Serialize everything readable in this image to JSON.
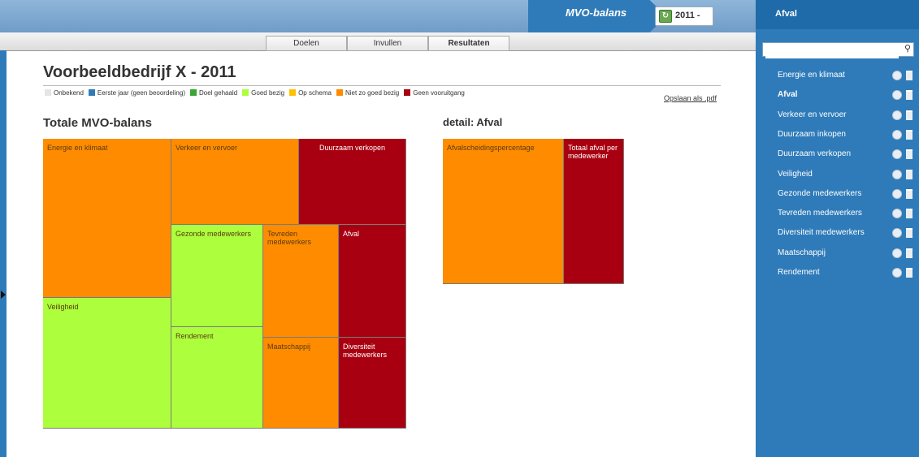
{
  "header": {
    "crumb_mvo": "MVO-balans",
    "crumb_year": "2011 -"
  },
  "tabs": [
    {
      "label": "Doelen",
      "active": false
    },
    {
      "label": "Invullen",
      "active": false
    },
    {
      "label": "Resultaten",
      "active": true
    }
  ],
  "sidebar": {
    "title": "Afval",
    "search_placeholder": "",
    "items": [
      {
        "label": "Energie en klimaat",
        "active": false
      },
      {
        "label": "Afval",
        "active": true
      },
      {
        "label": "Verkeer en vervoer",
        "active": false
      },
      {
        "label": "Duurzaam inkopen",
        "active": false
      },
      {
        "label": "Duurzaam verkopen",
        "active": false
      },
      {
        "label": "Veiligheid",
        "active": false
      },
      {
        "label": "Gezonde medewerkers",
        "active": false
      },
      {
        "label": "Tevreden medewerkers",
        "active": false
      },
      {
        "label": "Diversiteit medewerkers",
        "active": false
      },
      {
        "label": "Maatschappij",
        "active": false
      },
      {
        "label": "Rendement",
        "active": false
      }
    ]
  },
  "main": {
    "title": "Voorbeeldbedrijf X - 2011",
    "pdf_link": "Opslaan als .pdf",
    "legend": [
      {
        "label": "Onbekend",
        "color": "#e5e5e5"
      },
      {
        "label": "Eerste jaar (geen beoordeling)",
        "color": "#2f7bb9"
      },
      {
        "label": "Doel gehaald",
        "color": "#3aa635"
      },
      {
        "label": "Goed bezig",
        "color": "#adff3e"
      },
      {
        "label": "Op schema",
        "color": "#ffc000"
      },
      {
        "label": "Niet zo goed bezig",
        "color": "#ff8c00"
      },
      {
        "label": "Geen vooruitgang",
        "color": "#a80010"
      }
    ],
    "total_title": "Totale MVO-balans",
    "detail_title": "detail: Afval",
    "total_cells": [
      {
        "label": "Energie en klimaat",
        "status": "Niet zo goed bezig"
      },
      {
        "label": "Verkeer en vervoer",
        "status": "Niet zo goed bezig"
      },
      {
        "label": "Duurzaam verkopen",
        "status": "Geen vooruitgang"
      },
      {
        "label": "Veiligheid",
        "status": "Goed bezig"
      },
      {
        "label": "Gezonde medewerkers",
        "status": "Goed bezig"
      },
      {
        "label": "Tevreden medewerkers",
        "status": "Niet zo goed bezig"
      },
      {
        "label": "Afval",
        "status": "Geen vooruitgang"
      },
      {
        "label": "Rendement",
        "status": "Goed bezig"
      },
      {
        "label": "Maatschappij",
        "status": "Niet zo goed bezig"
      },
      {
        "label": "Diversiteit medewerkers",
        "status": "Geen vooruitgang"
      }
    ],
    "detail_cells": [
      {
        "label": "Afvalscheidingspercentage",
        "status": "Niet zo goed bezig"
      },
      {
        "label": "Totaal afval per medewerker",
        "status": "Geen vooruitgang"
      }
    ],
    "colors": {
      "orange": "#ff8c00",
      "red": "#a80010",
      "green": "#adff3e"
    }
  }
}
